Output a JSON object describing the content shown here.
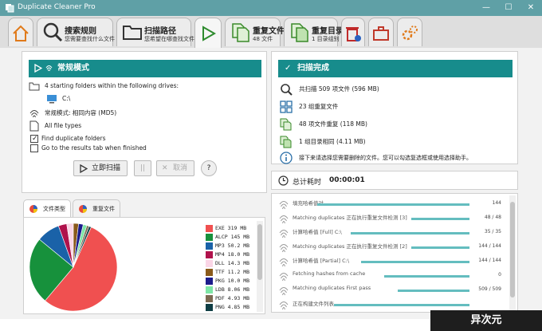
{
  "window": {
    "title": "Duplicate Cleaner Pro",
    "min_glyph": "—",
    "max_glyph": "☐",
    "close_glyph": "✕"
  },
  "tabs": [
    {
      "id": "home",
      "icon": "home-icon"
    },
    {
      "id": "search-rules",
      "label": "搜索规则",
      "sub": "您需要查找什么文件",
      "icon": "search-icon"
    },
    {
      "id": "scan-location",
      "label": "扫描路径",
      "sub": "您希望在哪查找文件",
      "icon": "folder-icon"
    },
    {
      "id": "scan",
      "icon": "play-icon"
    },
    {
      "id": "duplicate-files",
      "label": "重复文件",
      "sub": "48 文件",
      "icon": "duplicate-files-icon"
    },
    {
      "id": "duplicate-folders",
      "label": "重复目录",
      "sub": "1 目录组别",
      "icon": "duplicate-folders-icon"
    },
    {
      "id": "file-remover",
      "icon": "trash-icon"
    },
    {
      "id": "toolbox",
      "icon": "toolbox-icon"
    },
    {
      "id": "options",
      "icon": "gears-icon"
    }
  ],
  "scan_mode": {
    "header": "常规模式",
    "folders_text": "4 starting folders within the following drives:",
    "drive": "C:\\",
    "mode_text": "常规模式: 相同内容 (MD5)",
    "file_types_text": "All file types",
    "find_dup_folders_label": "Find duplicate folders",
    "find_dup_folders_checked": true,
    "goto_results_label": "Go to the results tab when finished",
    "goto_results_checked": false,
    "scan_button": "立即扫描",
    "pause_button": "||",
    "cancel_button": "取消",
    "help_button": "?"
  },
  "scan_complete": {
    "header": "扫描完成",
    "stats": [
      {
        "icon": "search-icon",
        "text": "共扫描 509 项文件 (596 MB)"
      },
      {
        "icon": "grid-icon",
        "text": "23 组重复文件"
      },
      {
        "icon": "duplicate-files-icon",
        "text": "48 项文件重复 (118 MB)"
      },
      {
        "icon": "duplicate-folders-icon",
        "text": "1 组目录相同 (4.11 MB)"
      },
      {
        "icon": "info-icon",
        "text": "接下来请选择您需要删除的文件。您可以勾选复选框或使用选择助手。"
      }
    ],
    "time_label": "总计耗时",
    "time_value": "00:00:01"
  },
  "log": [
    {
      "text": "填充哈希值对",
      "count": "144",
      "fill": 1.0
    },
    {
      "text": "Matching duplicates 正在执行重复文件检测 [3]",
      "count": "48 / 48",
      "fill": 1.0
    },
    {
      "text": "计算哈希值 [Full] C:\\",
      "count": "35 / 35",
      "fill": 1.0
    },
    {
      "text": "Matching duplicates 正在执行重复文件检测 [2]",
      "count": "144 / 144",
      "fill": 1.0
    },
    {
      "text": "计算哈希值 [Partial] C:\\",
      "count": "144 / 144",
      "fill": 1.0
    },
    {
      "text": "Fetching hashes from cache",
      "count": "0",
      "fill": 1.0
    },
    {
      "text": "Matching duplicates First pass",
      "count": "509 / 509",
      "fill": 1.0
    },
    {
      "text": "正在构建文件列表...",
      "count": "",
      "fill": 1.0
    }
  ],
  "chart_tabs": {
    "file_types": "文件类型",
    "duplicates": "重复文件"
  },
  "chart_data": {
    "type": "pie",
    "unit": "MB",
    "slices": [
      {
        "label": "EXE",
        "value": 319,
        "display": "319 MB",
        "color": "#f05050"
      },
      {
        "label": "ALCP",
        "value": 145,
        "display": "145 MB",
        "color": "#17913c"
      },
      {
        "label": "MP3",
        "value": 50.2,
        "display": "50.2 MB",
        "color": "#1a62a8"
      },
      {
        "label": "MP4",
        "value": 18.0,
        "display": "18.0 MB",
        "color": "#b0124c"
      },
      {
        "label": "DLL",
        "value": 14.3,
        "display": "14.3 MB",
        "color": "#fad5e6"
      },
      {
        "label": "TTF",
        "value": 11.2,
        "display": "11.2 MB",
        "color": "#8a5a1a"
      },
      {
        "label": "PKG",
        "value": 10.0,
        "display": "10.0 MB",
        "color": "#1c1c8c"
      },
      {
        "label": "LDB",
        "value": 8.06,
        "display": "8.06 MB",
        "color": "#7ee6a6"
      },
      {
        "label": "PDF",
        "value": 4.93,
        "display": "4.93 MB",
        "color": "#7d6a52"
      },
      {
        "label": "PNG",
        "value": 4.85,
        "display": "4.85 MB",
        "color": "#0f3e44"
      }
    ]
  },
  "watermark": "异次元 iPlaySoft.com"
}
